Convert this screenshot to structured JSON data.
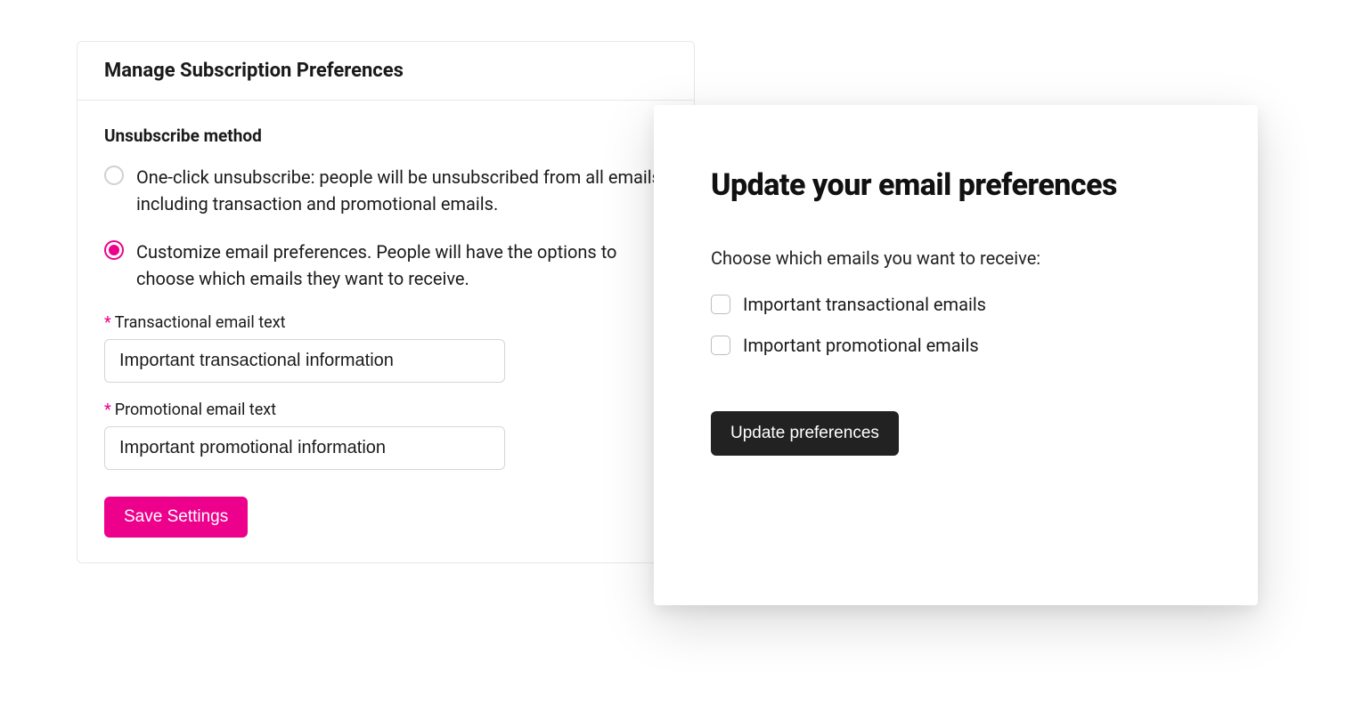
{
  "settings": {
    "title": "Manage Subscription Preferences",
    "section_label": "Unsubscribe method",
    "options": {
      "one_click": "One-click unsubscribe: people will be unsubscribed from all emails, including transaction and promotional emails.",
      "customize": "Customize email preferences. People will have the options to choose which emails they want to receive."
    },
    "fields": {
      "transactional": {
        "label": "Transactional email text",
        "value": "Important transactional information"
      },
      "promotional": {
        "label": "Promotional email text",
        "value": "Important promotional information"
      }
    },
    "save_button": "Save Settings"
  },
  "preview": {
    "title": "Update your email preferences",
    "subtitle": "Choose which emails you want to receive:",
    "checkboxes": {
      "transactional": "Important transactional emails",
      "promotional": "Important promotional emails"
    },
    "update_button": "Update preferences"
  }
}
